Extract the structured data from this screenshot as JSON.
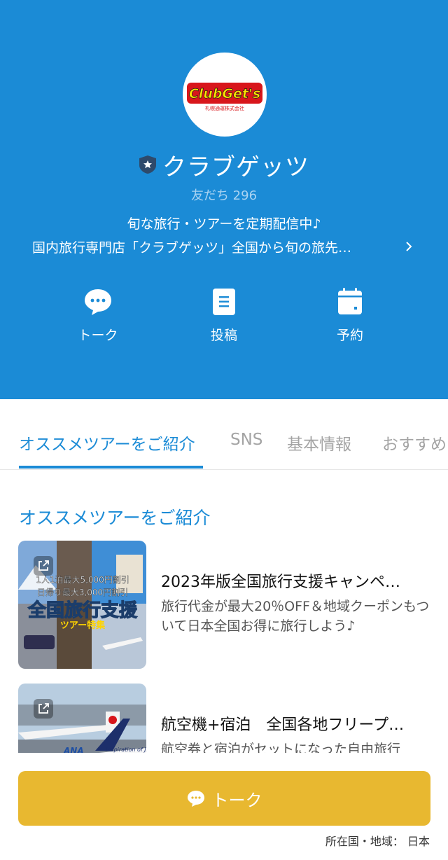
{
  "profile": {
    "logo_text": "ClubGet's",
    "logo_sub": "札幌通運株式会社",
    "badge_icon": "star-shield-icon",
    "name": "クラブゲッツ",
    "friends": "友だち 296",
    "description_line1": "旬な旅行・ツアーを定期配信中♪",
    "description_line2": "国内旅行専門店「クラブゲッツ」全国から旬の旅先…"
  },
  "actions": [
    {
      "label": "トーク",
      "icon": "chat-bubble-icon"
    },
    {
      "label": "投稿",
      "icon": "document-icon"
    },
    {
      "label": "予約",
      "icon": "calendar-icon"
    }
  ],
  "tabs": [
    {
      "label": "オススメツアーをご紹介",
      "active": true
    },
    {
      "label": "SNS",
      "active": false
    },
    {
      "label": "基本情報",
      "active": false
    },
    {
      "label": "おすすめ",
      "active": false
    }
  ],
  "section": {
    "title": "オススメツアーをご紹介",
    "cards": [
      {
        "title": "2023年版全国旅行支援キャンペ…",
        "description": "旅行代金が最大20％OFF＆地域クーポンもついて日本全国お得に旅行しよう♪",
        "thumb_lines": [
          "1人1泊最大5,000円割引",
          "日帰り最大3,000円割引",
          "全国旅行支援",
          "ツアー特集"
        ]
      },
      {
        "title": "航空機+宿泊　全国各地フリープ…",
        "description": "航空券と宿泊がセットになった自由旅行",
        "thumb_lines": [
          "Inspiration of JAPAN",
          "ANA"
        ]
      }
    ]
  },
  "talk_button": {
    "label": "トーク",
    "icon": "chat-bubble-icon",
    "color": "#e8b830"
  },
  "footer": {
    "region": "所在国・地域： 日本"
  },
  "colors": {
    "brand": "#1b8bd6",
    "button": "#e8b830"
  }
}
